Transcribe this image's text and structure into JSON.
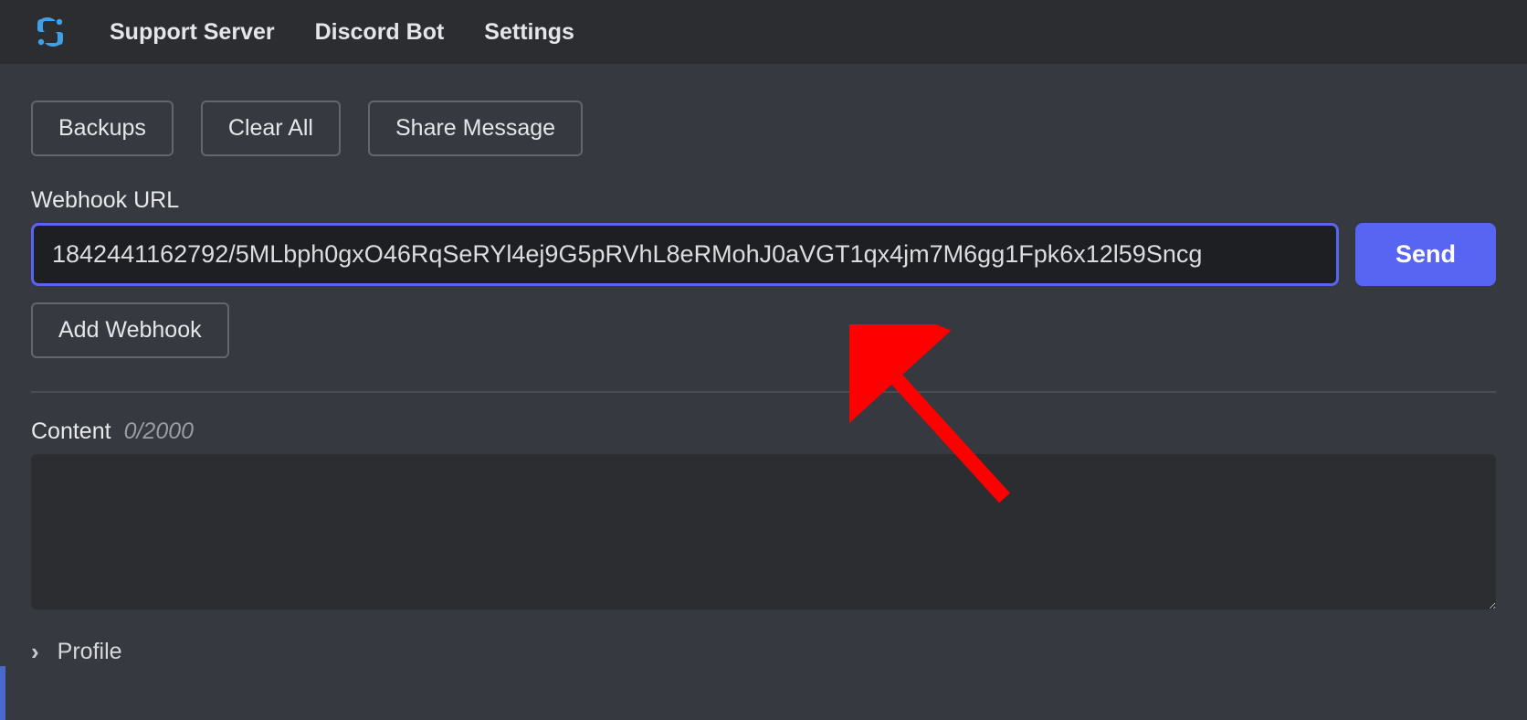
{
  "nav": {
    "support_server": "Support Server",
    "discord_bot": "Discord Bot",
    "settings": "Settings"
  },
  "actions": {
    "backups": "Backups",
    "clear_all": "Clear All",
    "share_message": "Share Message",
    "add_webhook": "Add Webhook",
    "send": "Send"
  },
  "webhook": {
    "label": "Webhook URL",
    "value": "1842441162792/5MLbph0gxO46RqSeRYl4ej9G5pRVhL8eRMohJ0aVGT1qx4jm7M6gg1Fpk6x12l59Sncg"
  },
  "content": {
    "label": "Content",
    "count": "0/2000",
    "value": ""
  },
  "profile": {
    "label": "Profile"
  },
  "colors": {
    "accent": "#5865f2",
    "bg_dark": "#1e1f22",
    "bg_panel": "#2b2d31",
    "bg_page": "#36393f",
    "annotation": "#ff0000"
  }
}
